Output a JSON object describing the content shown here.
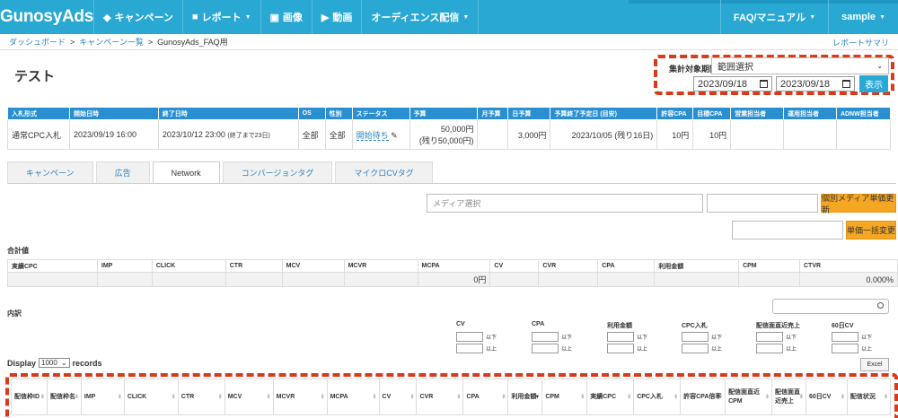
{
  "header": {
    "logo": "GunosyAds",
    "nav": [
      {
        "label": "キャンペーン",
        "icon": "tag-icon",
        "caret": false
      },
      {
        "label": "レポート",
        "icon": "chart-icon",
        "caret": true
      },
      {
        "label": "画像",
        "icon": "image-icon",
        "caret": false
      },
      {
        "label": "動画",
        "icon": "video-icon",
        "caret": false
      },
      {
        "label": "オーディエンス配信",
        "icon": "",
        "caret": true
      }
    ],
    "right": [
      {
        "label": "FAQ/マニュアル",
        "caret": true
      },
      {
        "label": "sample",
        "caret": true
      }
    ]
  },
  "breadcrumb": {
    "items": [
      "ダッシュボード",
      "キャンペーン一覧",
      "GunosyAds_FAQ用"
    ],
    "separator": ">",
    "right_link": "レポートサマリ"
  },
  "page": {
    "title": "テスト"
  },
  "period": {
    "label": "集計対象期間",
    "select_value": "範囲選択",
    "date_from": "2023/09/18",
    "date_to": "2023/09/18",
    "show_button": "表示"
  },
  "campaign_table": {
    "headers": [
      "入札形式",
      "開始日時",
      "終了日時",
      "OS",
      "性別",
      "ステータス",
      "予算",
      "月予算",
      "日予算",
      "予算終了予定日 (目安)",
      "許容CPA",
      "目標CPA",
      "営業担当者",
      "運用担当者",
      "ADNW担当者"
    ],
    "row": {
      "bid": "通常CPC入札",
      "start": "2023/09/19 16:00",
      "end": "2023/10/12 23:00",
      "end_note": "(終了まで23日)",
      "os": "全部",
      "gender": "全部",
      "status": "開始待ち",
      "budget": "50,000円",
      "budget_remaining": "(残り50,000円)",
      "monthly": "",
      "daily": "3,000円",
      "end_estimate": "2023/10/05 (残り16日)",
      "allowed_cpa": "10円",
      "target_cpa": "10円",
      "sales": "",
      "ops": "",
      "adnw": ""
    }
  },
  "tabs": [
    {
      "label": "キャンペーン",
      "active": false
    },
    {
      "label": "広告",
      "active": false
    },
    {
      "label": "Network",
      "active": true
    },
    {
      "label": "コンバージョンタグ",
      "active": false
    },
    {
      "label": "マイクロCVタグ",
      "active": false
    }
  ],
  "media": {
    "placeholder": "メディア選択",
    "update_button": "個別メディア単価更新",
    "bulk_button": "単価一括変更"
  },
  "totals": {
    "label": "合計値",
    "headers": [
      "実績CPC",
      "IMP",
      "CLICK",
      "CTR",
      "MCV",
      "MCVR",
      "MCPA",
      "CV",
      "CVR",
      "CPA",
      "利用金額",
      "CPM",
      "CTVR"
    ],
    "values": [
      "",
      "",
      "",
      "",
      "",
      "",
      "0円",
      "",
      "",
      "",
      "",
      "",
      "0.000%"
    ]
  },
  "breakdown": {
    "label": "内訳"
  },
  "filters": [
    {
      "label": "CV",
      "lte": "以下",
      "gte": "以上"
    },
    {
      "label": "CPA",
      "lte": "以下",
      "gte": "以上"
    },
    {
      "label": "利用金額",
      "lte": "以下",
      "gte": "以上"
    },
    {
      "label": "CPC入札",
      "lte": "以下",
      "gte": "以上"
    },
    {
      "label": "配信面直近売上",
      "lte": "以下",
      "gte": "以上"
    },
    {
      "label": "60日CV",
      "lte": "以下",
      "gte": "以上"
    }
  ],
  "display": {
    "prefix": "Display",
    "value": "1000",
    "suffix": "records"
  },
  "excel_button": "Excel",
  "detail_table": {
    "headers": [
      "配信枠ID",
      "配信枠名",
      "IMP",
      "CLICK",
      "CTR",
      "MCV",
      "MCVR",
      "MCPA",
      "CV",
      "CVR",
      "CPA",
      "利用金額",
      "CPM",
      "実績CPC",
      "CPC入札",
      "許容CPA倍率",
      "配信面直近CPM",
      "配信面直近売上",
      "60日CV",
      "配信状況"
    ]
  },
  "colors": {
    "header_bg": "#29a8d4",
    "table_header": "#2a8fd0",
    "accent": "#f5a623",
    "highlight": "#d83a1a"
  }
}
